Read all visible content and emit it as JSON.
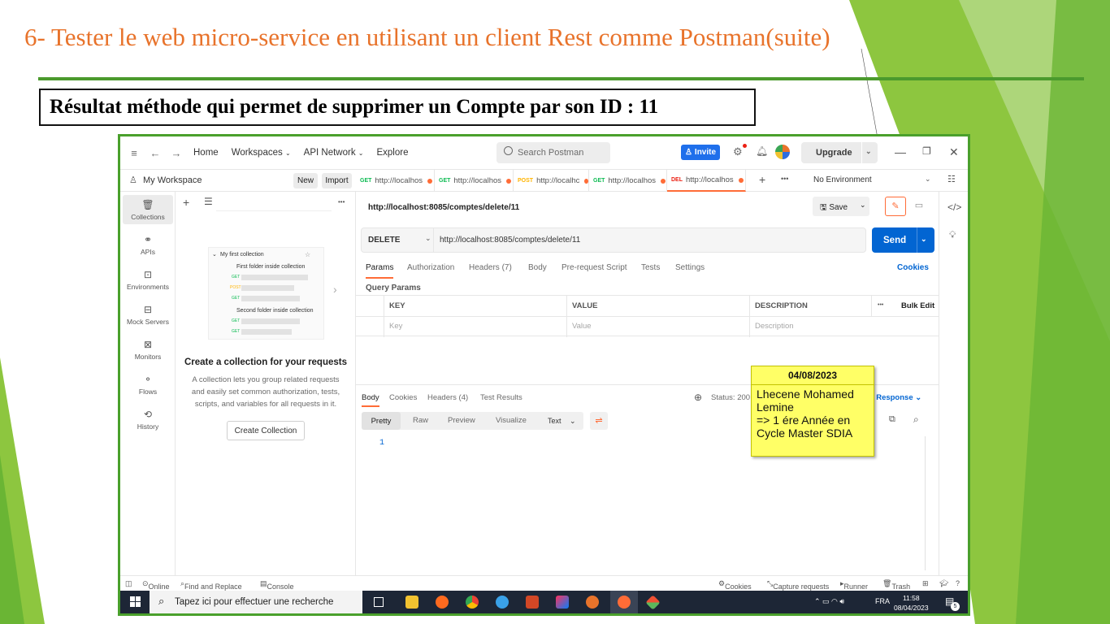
{
  "slide": {
    "title": "6- Tester le web micro-service en utilisant un client Rest comme Postman(suite)",
    "caption": "Résultat méthode qui permet de supprimer un Compte par son ID : 11",
    "colors": {
      "title": "#e8732b",
      "rule": "#4b9a2d",
      "leaf_green": "#8dc63f",
      "leaf_dark": "#4aa02c"
    }
  },
  "topbar": {
    "nav": [
      "Home",
      "Workspaces",
      "API Network",
      "Explore"
    ],
    "search_placeholder": "Search Postman",
    "invite_label": "Invite",
    "upgrade_label": "Upgrade"
  },
  "workspace": {
    "name": "My Workspace",
    "new_label": "New",
    "import_label": "Import",
    "environment": "No Environment"
  },
  "tabs": [
    {
      "method": "GET",
      "title": "http://localhos",
      "method_color": "#0cbb52"
    },
    {
      "method": "GET",
      "title": "http://localhos",
      "method_color": "#0cbb52"
    },
    {
      "method": "POST",
      "title": "http://localhc",
      "method_color": "#ffb400"
    },
    {
      "method": "GET",
      "title": "http://localhos",
      "method_color": "#0cbb52"
    },
    {
      "method": "DEL",
      "title": "http://localhos",
      "method_color": "#eb2013"
    }
  ],
  "sidebar": {
    "items": [
      {
        "label": "Collections",
        "icon": "collections-icon"
      },
      {
        "label": "APIs",
        "icon": "apis-icon"
      },
      {
        "label": "Environments",
        "icon": "environments-icon"
      },
      {
        "label": "Mock Servers",
        "icon": "mock-servers-icon"
      },
      {
        "label": "Monitors",
        "icon": "monitors-icon"
      },
      {
        "label": "Flows",
        "icon": "flows-icon"
      },
      {
        "label": "History",
        "icon": "history-icon"
      }
    ]
  },
  "collection_panel": {
    "preview_collection": "My first collection",
    "preview_folder1": "First folder inside collection",
    "preview_folder2": "Second folder inside collection",
    "preview_methods": [
      "GET",
      "POST",
      "GET",
      "GET",
      "GET"
    ],
    "title": "Create a collection for your requests",
    "description": "A collection lets you group related requests and easily set common authorization, tests, scripts, and variables for all requests in it.",
    "create_label": "Create Collection"
  },
  "request": {
    "title": "http://localhost:8085/comptes/delete/11",
    "save_label": "Save",
    "method": "DELETE",
    "url": "http://localhost:8085/comptes/delete/11",
    "send_label": "Send",
    "tabs": [
      "Params",
      "Authorization",
      "Headers (7)",
      "Body",
      "Pre-request Script",
      "Tests",
      "Settings"
    ],
    "cookies_label": "Cookies",
    "query_params_label": "Query Params",
    "columns": [
      "KEY",
      "VALUE",
      "DESCRIPTION"
    ],
    "bulk_edit_label": "Bulk Edit",
    "placeholders": [
      "Key",
      "Value",
      "Description"
    ]
  },
  "response": {
    "tabs": [
      "Body",
      "Cookies",
      "Headers (4)",
      "Test Results"
    ],
    "status_label": "Status: 200",
    "save_response_label": "ve Response",
    "formats": [
      "Pretty",
      "Raw",
      "Preview",
      "Visualize"
    ],
    "format_type": "Text",
    "line_number": "1"
  },
  "statusbar": {
    "online": "Online",
    "find_replace": "Find and Replace",
    "console": "Console",
    "cookies": "Cookies",
    "capture": "Capture requests",
    "runner": "Runner",
    "trash": "Trash"
  },
  "taskbar": {
    "search_placeholder": "Tapez ici pour effectuer une recherche",
    "lang": "FRA",
    "time": "11:58",
    "date": "08/04/2023",
    "notification_count": "5"
  },
  "sticky_note": {
    "date": "04/08/2023",
    "lines": [
      "Lhecene Mohamed",
      "Lemine",
      "=> 1 ére Année en",
      "Cycle Master SDIA"
    ]
  }
}
